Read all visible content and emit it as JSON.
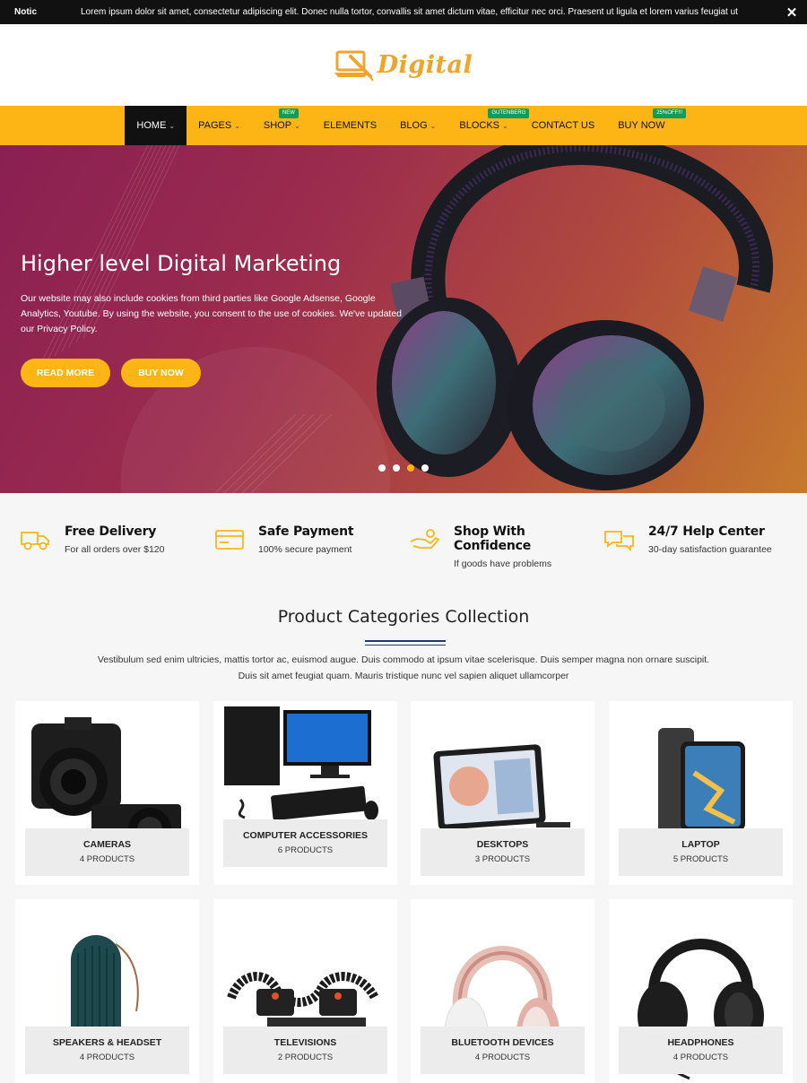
{
  "notice": {
    "tag": "Notic",
    "message": "Lorem ipsum dolor sit amet, consectetur adipiscing elit. Donec nulla tortor, convallis sit amet dictum vitae, efficitur nec orci. Praesent ut ligula et lorem varius feugiat ut",
    "close_symbol": "✕"
  },
  "logo": {
    "text": "Digital"
  },
  "nav": {
    "items": [
      {
        "label": "HOME",
        "chevron": "⌄"
      },
      {
        "label": "PAGES",
        "chevron": "⌄"
      },
      {
        "label": "SHOP",
        "chevron": "⌄",
        "badge": "NEW"
      },
      {
        "label": "ELEMENTS"
      },
      {
        "label": "BLOG",
        "chevron": "⌄"
      },
      {
        "label": "BLOCKS",
        "chevron": "⌄",
        "badge": "GUTENBERG"
      },
      {
        "label": "CONTACT US"
      },
      {
        "label": "BUY NOW",
        "badge": "25%OFF!!!"
      }
    ]
  },
  "hero": {
    "title": "Higher level Digital Marketing",
    "text": "Our website may also include cookies from third parties like Google Adsense, Google Analytics, Youtube. By using the website, you consent to the use of cookies. We've updated our Privacy Policy.",
    "read_more": "READ MORE",
    "buy_now": "BUY NOW",
    "slides": 4,
    "active_slide": 3
  },
  "features": [
    {
      "icon": "truck-icon",
      "title": "Free Delivery",
      "desc": "For all orders over $120"
    },
    {
      "icon": "credit-card-icon",
      "title": "Safe Payment",
      "desc": "100% secure payment"
    },
    {
      "icon": "hand-money-icon",
      "title": "Shop With Confidence",
      "desc": "If goods have problems"
    },
    {
      "icon": "chat-bubbles-icon",
      "title": "24/7 Help Center",
      "desc": "30-day satisfaction guarantee"
    }
  ],
  "categories_section": {
    "title": "Product Categories Collection",
    "description": "Vestibulum sed enim ultricies, mattis tortor ac, euismod augue. Duis commodo at ipsum vitae scelerisque. Duis semper magna non ornare suscipit. Duis sit amet feugiat quam. Mauris tristique nunc vel sapien aliquet ullamcorper"
  },
  "categories": [
    {
      "name": "CAMERAS",
      "count": "4 PRODUCTS"
    },
    {
      "name": "COMPUTER ACCESSORIES",
      "count": "6 PRODUCTS"
    },
    {
      "name": "DESKTOPS",
      "count": "3 PRODUCTS"
    },
    {
      "name": "LAPTOP",
      "count": "5 PRODUCTS"
    },
    {
      "name": "SPEAKERS & HEADSET",
      "count": "4 PRODUCTS"
    },
    {
      "name": "TELEVISIONS",
      "count": "2 PRODUCTS"
    },
    {
      "name": "BLUETOOTH DEVICES",
      "count": "4 PRODUCTS"
    },
    {
      "name": "HEADPHONES",
      "count": "4 PRODUCTS"
    }
  ],
  "colors": {
    "accent": "#fdb515",
    "dark": "#111111",
    "badge": "#0e9d5a",
    "logo": "#f0a428"
  }
}
